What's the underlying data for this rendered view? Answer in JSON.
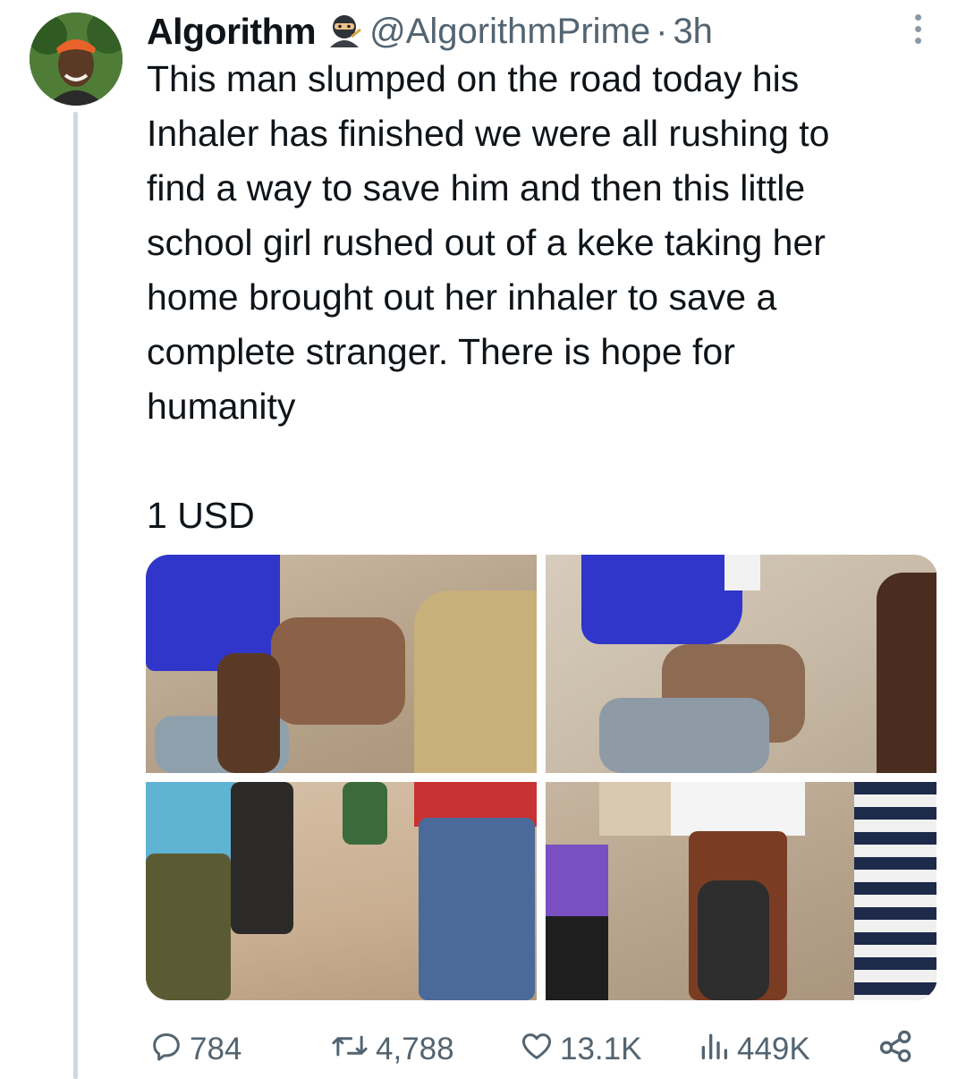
{
  "author": {
    "name": "Algorithm",
    "badge_icon": "ninja-emoji-icon",
    "handle": "@AlgorithmPrime",
    "separator": "·",
    "time": "3h"
  },
  "tweet": {
    "text": "This man slumped on the road today his\nInhaler has finished we were all rushing to\nfind a way to save him and then this little\nschool girl rushed out of a keke taking her\nhome brought out her inhaler to save a\ncomplete stranger. There is hope for\nhumanity",
    "amount": "1 USD"
  },
  "media": {
    "count": 4,
    "items": [
      "photo-top-left",
      "photo-top-right",
      "photo-bottom-left",
      "photo-bottom-right"
    ]
  },
  "actions": {
    "replies": "784",
    "retweets": "4,788",
    "likes": "13.1K",
    "views": "449K",
    "icons": [
      "reply-icon",
      "retweet-icon",
      "like-icon",
      "views-icon",
      "share-icon"
    ]
  },
  "colors": {
    "text": "#0f1419",
    "secondary": "#536471",
    "thread_line": "#cfd9de"
  }
}
